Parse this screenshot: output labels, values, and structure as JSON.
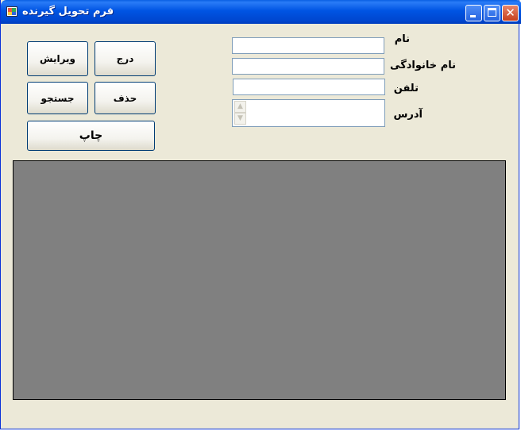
{
  "window": {
    "title": "فرم تحویل گیرنده",
    "controls": {
      "minimize": "minimize-icon",
      "maximize": "maximize-icon",
      "close": "close-icon"
    }
  },
  "form": {
    "labels": {
      "name": "نام",
      "family": "نام خانوادگی",
      "phone": "تلفن",
      "address": "آدرس"
    },
    "fields": {
      "name": "",
      "family": "",
      "phone": "",
      "address": ""
    }
  },
  "buttons": {
    "insert": "درج",
    "edit": "ویرایش",
    "delete": "حذف",
    "search": "جستجو",
    "print": "چاپ"
  },
  "colors": {
    "titlebar": "#0054e3",
    "form_background": "#ece9d8",
    "grid_background": "#808080"
  }
}
